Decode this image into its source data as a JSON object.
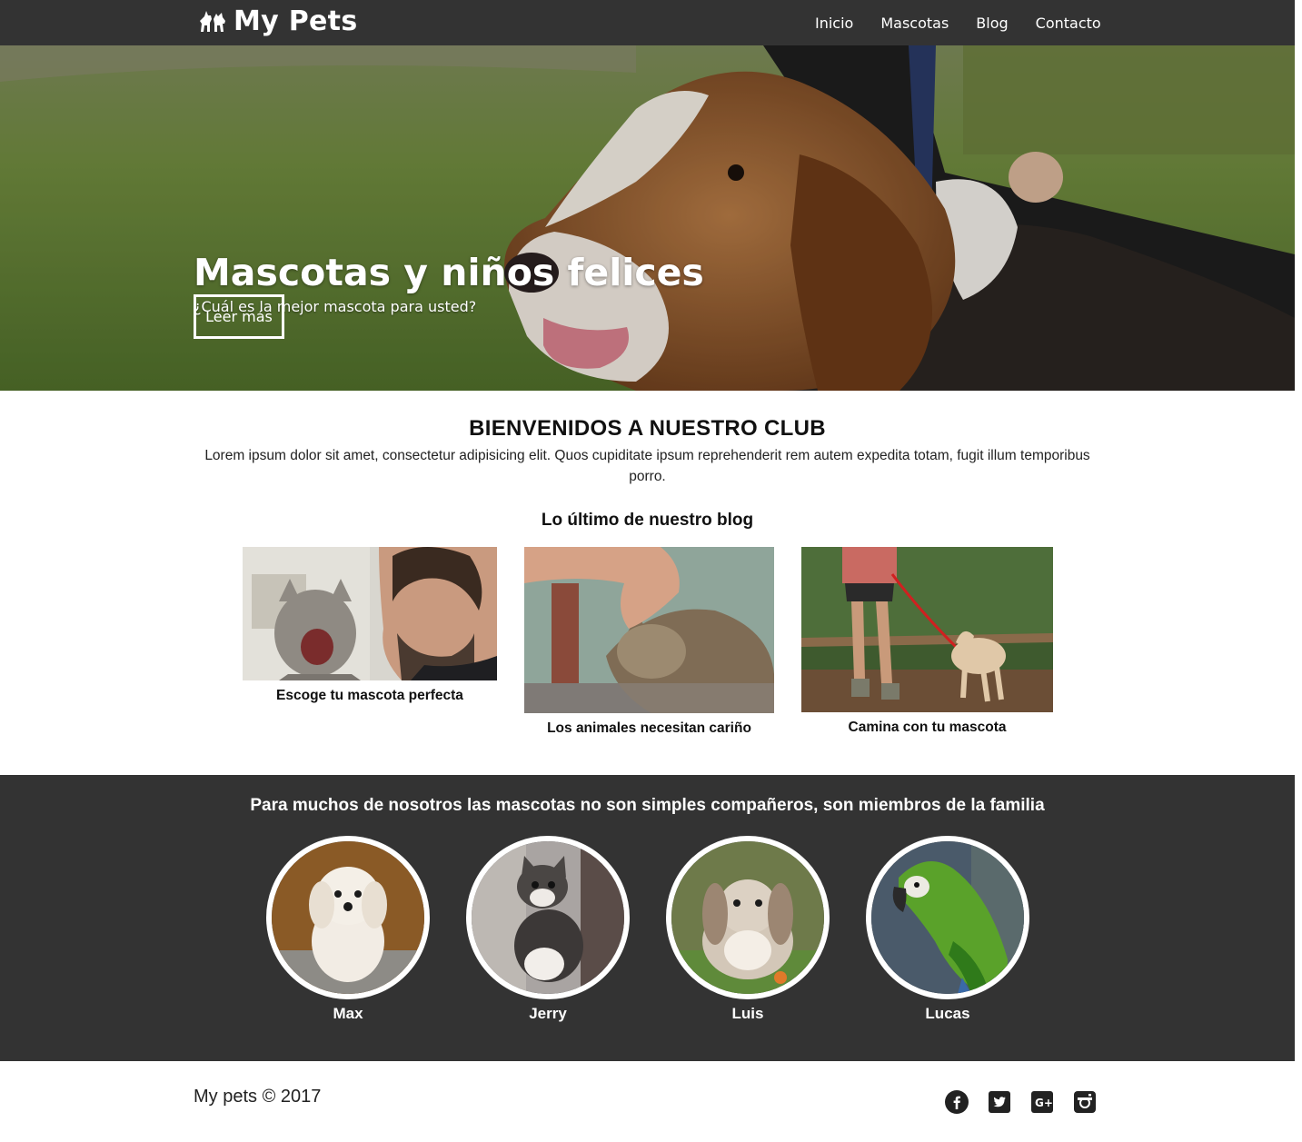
{
  "header": {
    "logo_text": "My Pets",
    "nav": [
      "Inicio",
      "Mascotas",
      "Blog",
      "Contacto"
    ]
  },
  "hero": {
    "title": "Mascotas y niños felices",
    "subtitle": "¿Cuál es la mejor mascota para usted?",
    "button": "Leer más"
  },
  "welcome": {
    "title": "BIENVENIDOS A NUESTRO CLUB",
    "text": "Lorem ipsum dolor sit amet, consectetur adipisicing elit. Quos cupiditate ipsum reprehenderit rem autem expedita totam, fugit illum temporibus porro."
  },
  "blog": {
    "title": "Lo último de nuestro blog",
    "posts": [
      {
        "caption": "Escoge tu mascota perfecta"
      },
      {
        "caption": "Los animales necesitan cariño"
      },
      {
        "caption": "Camina con tu mascota"
      }
    ]
  },
  "pets_section": {
    "title": "Para muchos de nosotros las mascotas no son simples compañeros, son miembros de la familia",
    "pets": [
      {
        "name": "Max"
      },
      {
        "name": "Jerry"
      },
      {
        "name": "Luis"
      },
      {
        "name": "Lucas"
      }
    ]
  },
  "footer": {
    "copyright": "My pets © 2017",
    "social_icons": [
      "facebook-icon",
      "twitter-icon",
      "google-plus-icon",
      "instagram-icon"
    ]
  },
  "colors": {
    "header_bg": "#333333",
    "band_bg": "#333333",
    "text_dark": "#222222",
    "white": "#ffffff"
  }
}
